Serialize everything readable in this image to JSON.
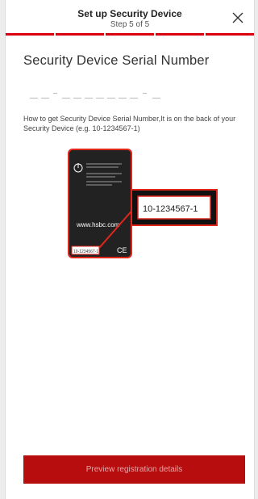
{
  "header": {
    "title": "Set up Security Device",
    "step": "Step 5 of 5"
  },
  "progress": {
    "steps_total": 5,
    "steps_completed": 5,
    "accent": "#db0011"
  },
  "main": {
    "title": "Security Device Serial Number",
    "serial_input": {
      "value": "",
      "format": "__-_______-_"
    },
    "help_text": "How to get Security Device Serial Number,It is on the back of your Security Device (e.g. 10-1234567-1)",
    "device_image": {
      "serial_callout": "10-1234567-1",
      "website": "www.hsbc.com",
      "back_serial": "10-1234567-1"
    }
  },
  "footer": {
    "button_label": "Preview registration details",
    "button_color": "#b80d0f"
  }
}
